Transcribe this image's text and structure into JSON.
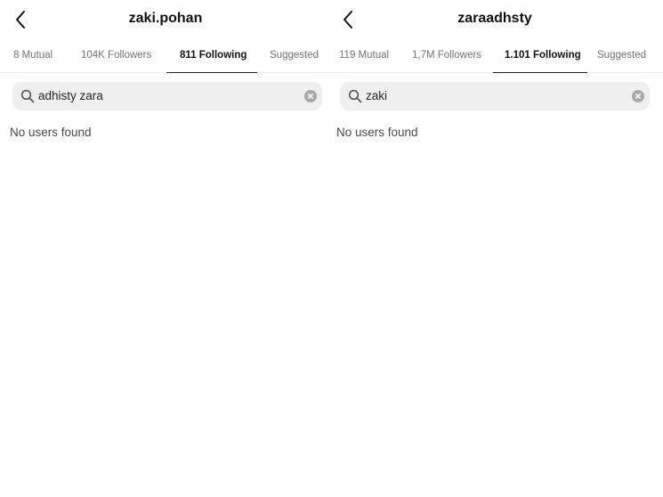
{
  "left": {
    "username": "zaki.pohan",
    "tabs": [
      {
        "label": "8 Mutual"
      },
      {
        "label": "104K Followers"
      },
      {
        "label": "811 Following"
      },
      {
        "label": "Suggested"
      }
    ],
    "active_tab": "811 Following",
    "search_query": "adhisty zara",
    "empty_message": "No users found"
  },
  "right": {
    "username": "zaraadhsty",
    "tabs": [
      {
        "label": "119 Mutual"
      },
      {
        "label": "1,7M Followers"
      },
      {
        "label": "1.101 Following"
      },
      {
        "label": "Suggested"
      }
    ],
    "active_tab": "1.101 Following",
    "search_query": "zaki",
    "empty_message": "No users found"
  },
  "icons": {
    "back": "chevron-left-icon",
    "search": "search-icon",
    "clear": "clear-search-icon"
  },
  "colors": {
    "active_text": "#111111",
    "inactive_text": "#737373",
    "search_bg": "#efefef"
  }
}
